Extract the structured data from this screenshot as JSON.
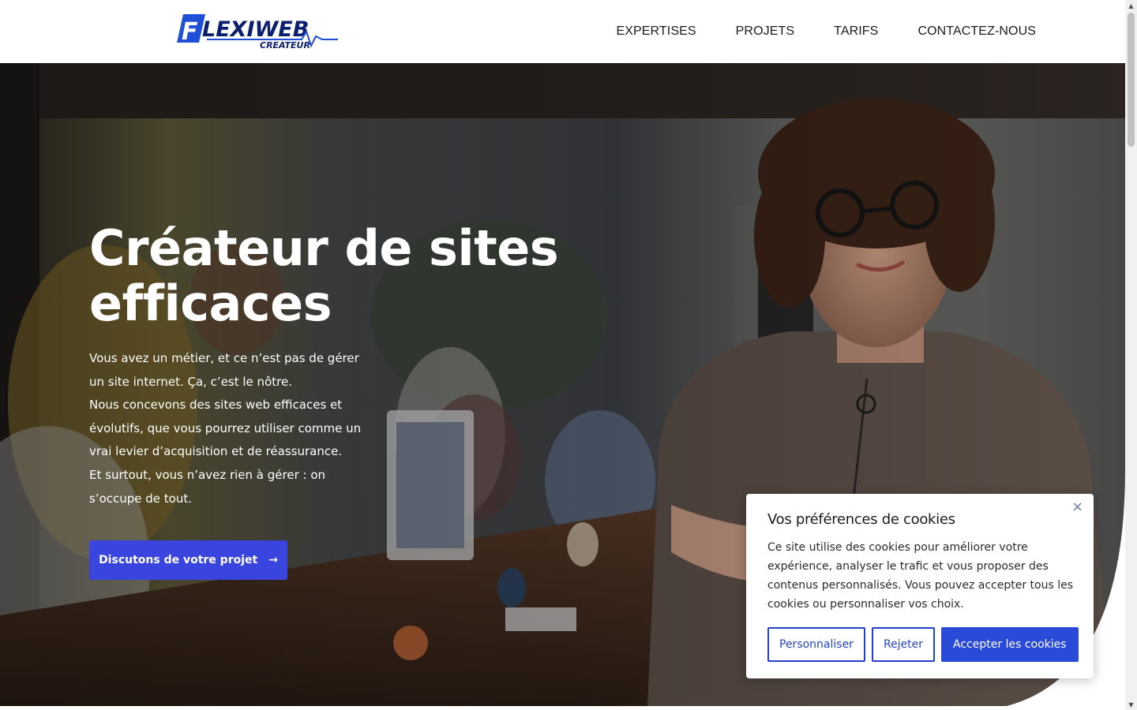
{
  "header": {
    "logo_text": "FLEXIWEB",
    "logo_subtext": "CREATEUR",
    "nav": [
      "EXPERTISES",
      "PROJETS",
      "TARIFS",
      "CONTACTEZ-NOUS"
    ]
  },
  "hero": {
    "title_line1": "Créateur de sites",
    "title_line2": "efficaces",
    "paragraph1": "Vous avez un métier, et ce n’est pas de gérer un site internet. Ça, c’est le nôtre.",
    "paragraph2": "Nous concevons des sites web efficaces et évolutifs, que vous pourrez utiliser comme un vrai levier d’acquisition et de réassurance.",
    "paragraph3": "Et surtout, vous n’avez rien à gérer : on s’occupe de tout.",
    "cta_label": "Discutons de votre projet",
    "cta_arrow": "→"
  },
  "cookie": {
    "title": "Vos préférences de cookies",
    "text": "Ce site utilise des cookies pour améliorer votre expérience, analyser le trafic et vous proposer des contenus personnalisés. Vous pouvez accepter tous les cookies ou personnaliser vos choix.",
    "close": "×",
    "btn_customize": "Personnaliser",
    "btn_reject": "Rejeter",
    "btn_accept": "Accepter les cookies"
  },
  "colors": {
    "accent": "#3a45e0",
    "cookie_accent": "#2a4bd8",
    "logo_blue": "#1f4fd8",
    "text_dark": "#1b1b1b"
  },
  "icons": {
    "arrow": "arrow-right-icon",
    "close": "close-icon",
    "scroll_up": "scroll-up-icon",
    "scroll_down": "scroll-down-icon"
  }
}
